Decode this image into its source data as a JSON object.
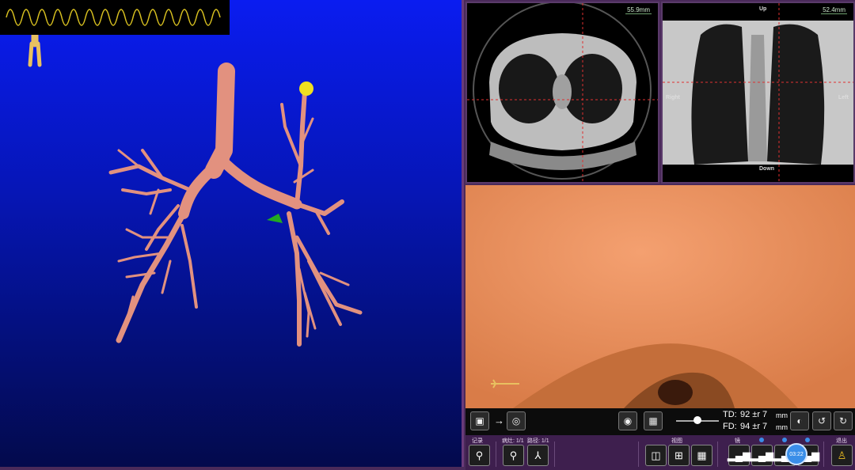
{
  "axial": {
    "scale": "55.9mm"
  },
  "coronal": {
    "scale": "52.4mm",
    "up": "Up",
    "down": "Down",
    "right": "Right",
    "left": "Left"
  },
  "control": {
    "td_label": "TD:",
    "td_value": "92 ±r 7",
    "td_unit": "mm",
    "fd_label": "FD:",
    "fd_value": "94 ±r 7",
    "fd_unit": "mm",
    "arrow": "→"
  },
  "toolbar": {
    "record_label": "记录",
    "lesion_label": "病灶: 1/1",
    "path_label": "路径: 1/1",
    "view_label": "视图",
    "scope_label": "镜",
    "exit_label": "退出",
    "timer": "03:22"
  },
  "colors": {
    "airway": "#e2917f",
    "background_top": "#0a1cf0",
    "accent": "#3a8ee8",
    "lesion": "#f0e020",
    "marker": "#22aa22"
  }
}
